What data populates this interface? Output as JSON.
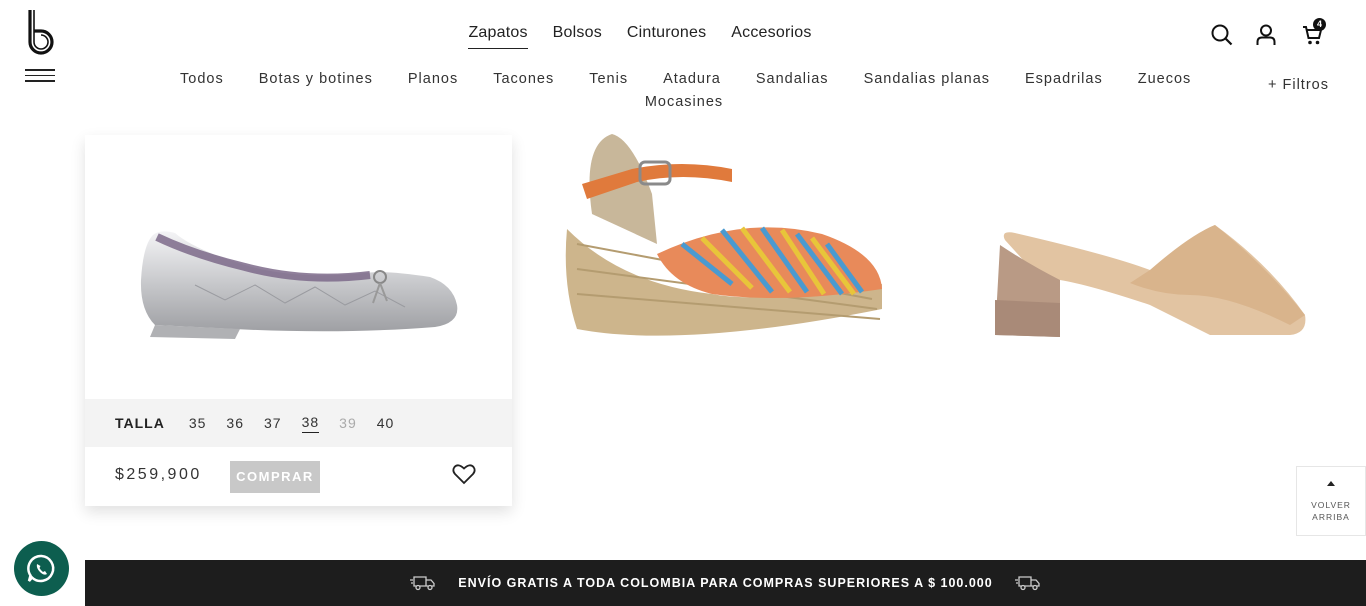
{
  "header": {
    "main_nav": [
      {
        "label": "Zapatos",
        "active": true
      },
      {
        "label": "Bolsos",
        "active": false
      },
      {
        "label": "Cinturones",
        "active": false
      },
      {
        "label": "Accesorios",
        "active": false
      }
    ],
    "cart_count": "4",
    "sub_nav_row1": [
      "Todos",
      "Botas y botines",
      "Planos",
      "Tacones",
      "Tenis",
      "Atadura",
      "Sandalias",
      "Sandalias planas",
      "Espadrilas",
      "Zuecos"
    ],
    "sub_nav_row2": [
      "Mocasines"
    ],
    "filters_label": "+ Filtros"
  },
  "product_card": {
    "size_label": "TALLA",
    "sizes": [
      {
        "value": "35",
        "state": "available"
      },
      {
        "value": "36",
        "state": "available"
      },
      {
        "value": "37",
        "state": "available"
      },
      {
        "value": "38",
        "state": "selected"
      },
      {
        "value": "39",
        "state": "unavailable"
      },
      {
        "value": "40",
        "state": "available"
      }
    ],
    "price": "$259,900",
    "buy_label": "COMPRAR"
  },
  "back_to_top": {
    "line1": "VOLVER",
    "line2": "ARRIBA"
  },
  "shipping_banner": {
    "message": "ENVÍO GRATIS A TODA COLOMBIA PARA COMPRAS SUPERIORES A $ 100.000"
  },
  "colors": {
    "dark_bar": "#1d1d1d",
    "whatsapp": "#0d5e4f",
    "buy_button": "#c8c8c8"
  }
}
